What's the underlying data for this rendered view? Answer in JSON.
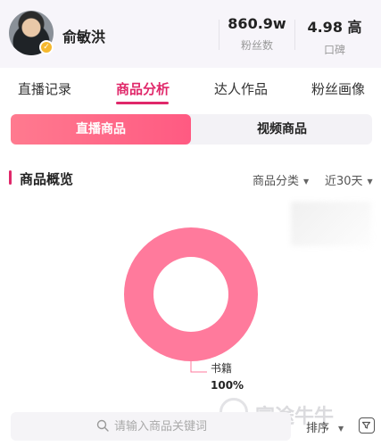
{
  "header": {
    "name": "俞敏洪",
    "stats": [
      {
        "value": "860.9w",
        "label": "粉丝数"
      },
      {
        "value": "4.98 高",
        "label": "口碑"
      }
    ]
  },
  "tabs": [
    {
      "label": "直播记录",
      "active": false
    },
    {
      "label": "商品分析",
      "active": true
    },
    {
      "label": "达人作品",
      "active": false
    },
    {
      "label": "粉丝画像",
      "active": false
    }
  ],
  "segment": {
    "active": "直播商品",
    "inactive": "视频商品"
  },
  "section": {
    "title": "商品概览",
    "filter_category": "商品分类",
    "filter_period": "近30天"
  },
  "colors": {
    "accent": "#e0286a",
    "donut": "#ff7a9c",
    "segment_active": "#ff6a88"
  },
  "chart_data": {
    "type": "pie",
    "donut": true,
    "slices": [
      {
        "label": "书籍",
        "value": 100,
        "display": "100%"
      }
    ]
  },
  "search": {
    "placeholder": "请输入商品关键词"
  },
  "sort_label": "排序",
  "watermark": "富途牛牛"
}
